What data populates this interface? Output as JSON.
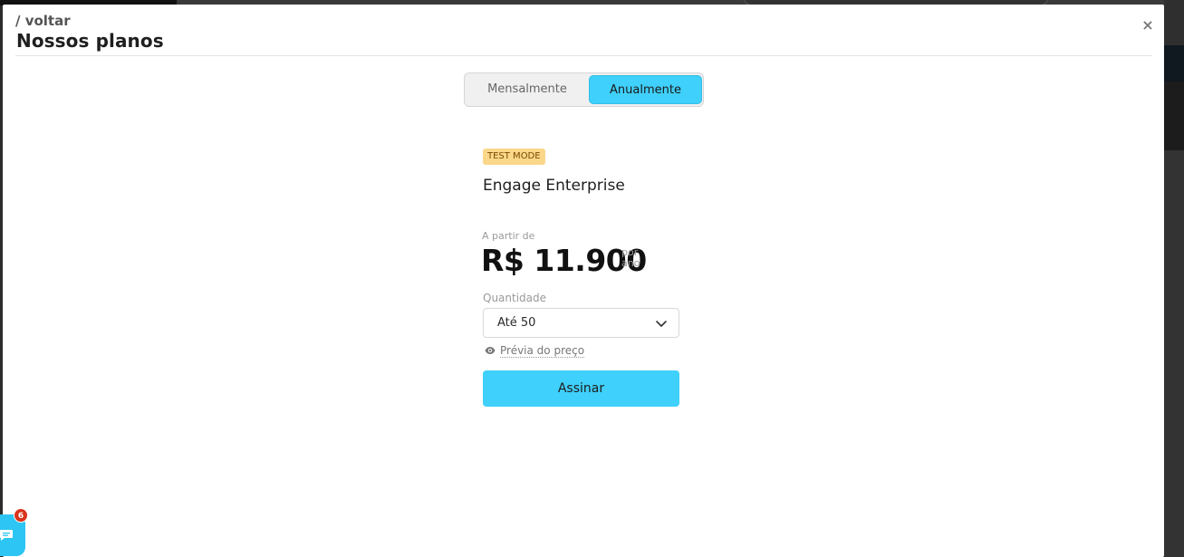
{
  "header": {
    "back_label": "/ voltar",
    "title": "Nossos planos",
    "close_label": "×"
  },
  "billing_toggle": {
    "options": [
      {
        "label": "Mensalmente",
        "selected": false
      },
      {
        "label": "Anualmente",
        "selected": true
      }
    ]
  },
  "plan": {
    "badge": "TEST MODE",
    "name": "Engage Enterprise",
    "from_label": "A partir de",
    "price": "R$ 11.900",
    "period_line1": "por",
    "period_line2": "ano",
    "quantity_label": "Quantidade",
    "quantity_value": "Até 50",
    "preview_label": "Prévia do preço",
    "subscribe_label": "Assinar"
  },
  "chat_widget": {
    "unread_count": "6",
    "icon": "chat-icon"
  },
  "colors": {
    "accent": "#3fd0fb",
    "badge_bg": "#fbd78a",
    "notification": "#d9331c"
  }
}
